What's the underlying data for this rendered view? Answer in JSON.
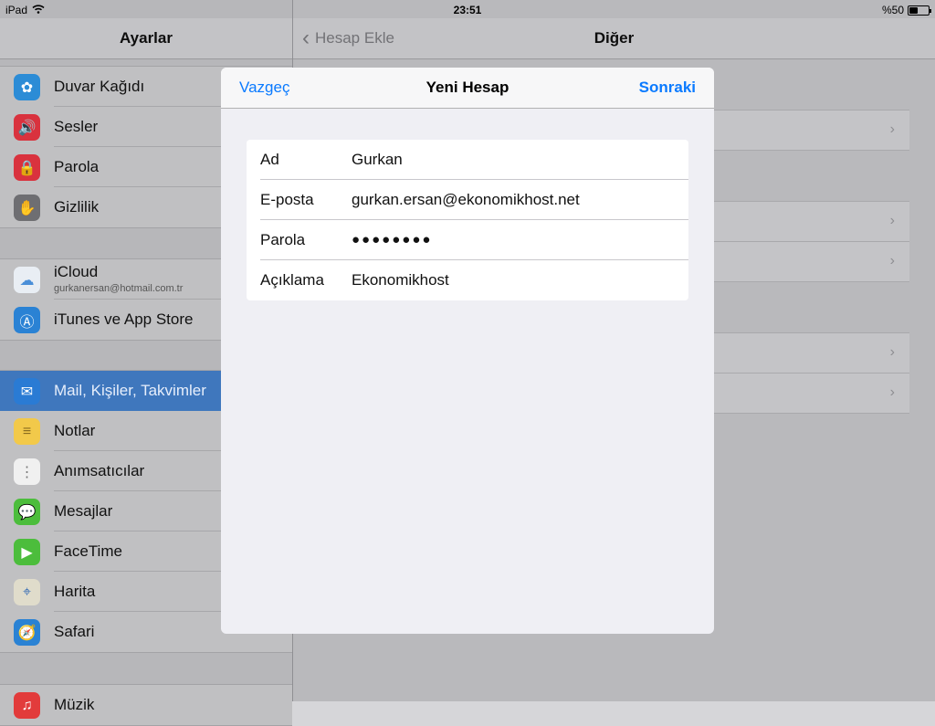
{
  "status": {
    "device": "iPad",
    "time": "23:51",
    "battery_text": "%50",
    "battery_level": 0.5
  },
  "master": {
    "title": "Ayarlar",
    "groups": [
      [
        {
          "label": "Duvar Kağıdı",
          "icon": "flower-icon",
          "color": "#2c8cd6"
        },
        {
          "label": "Sesler",
          "icon": "speaker-icon",
          "color": "#d9323e"
        },
        {
          "label": "Parola",
          "icon": "lock-icon",
          "color": "#d9323e"
        },
        {
          "label": "Gizlilik",
          "icon": "hand-icon",
          "color": "#6e6e72"
        }
      ],
      [
        {
          "label": "iCloud",
          "sublabel": "gurkanersan@hotmail.com.tr",
          "icon": "cloud-icon",
          "color": "#e9eef4"
        },
        {
          "label": "iTunes ve App Store",
          "icon": "app-store-icon",
          "color": "#2a82d4"
        }
      ],
      [
        {
          "label": "Mail, Kişiler, Takvimler",
          "icon": "mail-icon",
          "color": "#2a7bd4",
          "selected": true
        },
        {
          "label": "Notlar",
          "icon": "notes-icon",
          "color": "#f2c94a"
        },
        {
          "label": "Anımsatıcılar",
          "icon": "reminders-icon",
          "color": "#f0f0f0"
        },
        {
          "label": "Mesajlar",
          "icon": "message-icon",
          "color": "#4cbd3c"
        },
        {
          "label": "FaceTime",
          "icon": "video-camera-icon",
          "color": "#4cbd3c"
        },
        {
          "label": "Harita",
          "icon": "map-icon",
          "color": "#e0dccb"
        },
        {
          "label": "Safari",
          "icon": "compass-icon",
          "color": "#2a82d4"
        }
      ],
      [
        {
          "label": "Müzik",
          "icon": "music-icon",
          "color": "#e23b3b"
        }
      ]
    ]
  },
  "detail": {
    "back_label": "Hesap Ekle",
    "title": "Diğer"
  },
  "modal": {
    "cancel_label": "Vazgeç",
    "title": "Yeni Hesap",
    "next_label": "Sonraki",
    "fields": [
      {
        "label": "Ad",
        "value": "Gurkan"
      },
      {
        "label": "E-posta",
        "value": "gurkan.ersan@ekonomikhost.net"
      },
      {
        "label": "Parola",
        "value": "●●●●●●●●"
      },
      {
        "label": "Açıklama",
        "value": "Ekonomikhost"
      }
    ]
  }
}
